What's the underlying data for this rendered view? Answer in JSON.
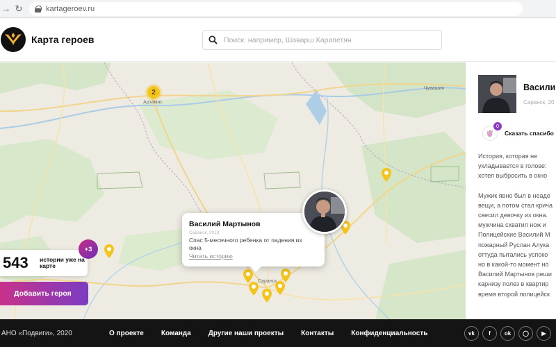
{
  "browser": {
    "url": "kartageroev.ru"
  },
  "header": {
    "brand": "Карта героев",
    "search_placeholder": "Поиск: например, Шаварш Карапетян"
  },
  "map": {
    "places": [
      "Арзамас",
      "Чувашия",
      "Саранск"
    ],
    "cluster_count": "2",
    "popup": {
      "name": "Василий Мартынов",
      "subtitle": "Саранск, 2019",
      "description": "Спас 5-месячного ребенка от падения из окна",
      "link": "Читать историю"
    },
    "counter": {
      "value": "543",
      "label": "истории уже на карте"
    },
    "more_badge": "+3",
    "add_button": "Добавить героя"
  },
  "panel": {
    "name": "Василий",
    "meta": "Саранск, 20",
    "thanks_count": "0",
    "thanks_label": "Сказать спасибо",
    "paragraph1": [
      "История, которая не",
      "укладывается в голове:",
      "хотел выбросить в окно"
    ],
    "paragraph2": [
      "Мужик явно был в неаде",
      "вещи, а потом стал крича",
      "свесил девочку из окна.",
      "мужчина схватил нож и",
      "Полицейские Василий М",
      "пожарный Руслан Алука",
      "оттуда пытались успоко",
      "но в какой-то момент но",
      "Василий Мартынов реши",
      "карнизу полез в квартир",
      "время второй полицейск"
    ]
  },
  "footer": {
    "copyright": "АНО «Подвиги», 2020",
    "links": [
      "О проекте",
      "Команда",
      "Другие наши проекты",
      "Контакты",
      "Конфиденциальность"
    ],
    "social": [
      "vk-icon",
      "facebook-icon",
      "odnoklassniki-icon",
      "instagram-icon",
      "youtube-icon"
    ]
  },
  "colors": {
    "accent_pink": "#c8328a",
    "accent_purple": "#7b3cc2",
    "pin_yellow": "#f3c41b",
    "footer_bg": "#141414"
  }
}
